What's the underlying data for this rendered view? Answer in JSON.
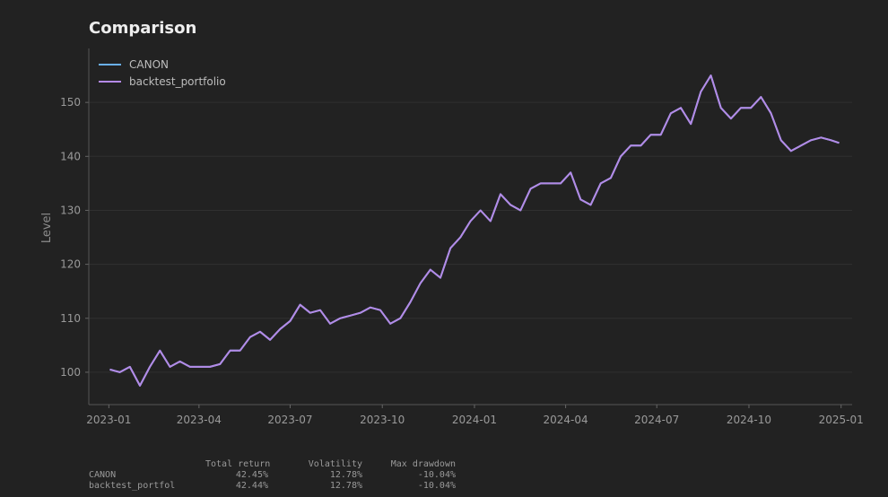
{
  "chart_data": {
    "type": "line",
    "title": "Comparison",
    "xlabel": "",
    "ylabel": "Level",
    "x_ticks": [
      "2023-01",
      "2023-04",
      "2023-07",
      "2023-10",
      "2024-01",
      "2024-04",
      "2024-07",
      "2024-10",
      "2025-01"
    ],
    "y_ticks": [
      100,
      110,
      120,
      130,
      140,
      150
    ],
    "xlim": [
      "2022-12-12",
      "2025-01-12"
    ],
    "ylim": [
      94,
      160
    ],
    "grid": "horizontal",
    "legend_position": "top-left",
    "colors": {
      "background": "#222222",
      "canon": "#6ab0ee",
      "backtest": "#b48ae6",
      "grid": "#303030"
    },
    "x": [
      "2023-01-02",
      "2023-01-12",
      "2023-01-22",
      "2023-02-01",
      "2023-02-11",
      "2023-02-21",
      "2023-03-03",
      "2023-03-13",
      "2023-03-23",
      "2023-04-02",
      "2023-04-12",
      "2023-04-22",
      "2023-05-02",
      "2023-05-12",
      "2023-05-22",
      "2023-06-01",
      "2023-06-11",
      "2023-06-21",
      "2023-07-01",
      "2023-07-11",
      "2023-07-21",
      "2023-07-31",
      "2023-08-10",
      "2023-08-20",
      "2023-08-30",
      "2023-09-09",
      "2023-09-19",
      "2023-09-29",
      "2023-10-09",
      "2023-10-19",
      "2023-10-29",
      "2023-11-08",
      "2023-11-18",
      "2023-11-28",
      "2023-12-08",
      "2023-12-18",
      "2023-12-28",
      "2024-01-07",
      "2024-01-17",
      "2024-01-27",
      "2024-02-06",
      "2024-02-16",
      "2024-02-26",
      "2024-03-07",
      "2024-03-17",
      "2024-03-27",
      "2024-04-06",
      "2024-04-16",
      "2024-04-26",
      "2024-05-06",
      "2024-05-16",
      "2024-05-26",
      "2024-06-05",
      "2024-06-15",
      "2024-06-25",
      "2024-07-05",
      "2024-07-15",
      "2024-07-25",
      "2024-08-04",
      "2024-08-14",
      "2024-08-24",
      "2024-09-03",
      "2024-09-13",
      "2024-09-23",
      "2024-10-03",
      "2024-10-13",
      "2024-10-23",
      "2024-11-02",
      "2024-11-12",
      "2024-11-22",
      "2024-12-02",
      "2024-12-12",
      "2024-12-22",
      "2024-12-30"
    ],
    "series": [
      {
        "name": "CANON",
        "values": [
          100.5,
          100.0,
          101.0,
          97.5,
          101.0,
          104.0,
          101.0,
          102.0,
          101.0,
          101.0,
          101.0,
          101.5,
          104.0,
          104.0,
          106.5,
          107.5,
          106.0,
          108.0,
          109.5,
          112.5,
          111.0,
          111.5,
          109.0,
          110.0,
          110.5,
          111.0,
          112.0,
          111.5,
          109.0,
          110.0,
          113.0,
          116.5,
          119.0,
          117.5,
          123.0,
          125.0,
          128.0,
          130.0,
          128.0,
          133.0,
          131.0,
          130.0,
          134.0,
          135.0,
          135.0,
          135.0,
          137.0,
          132.0,
          131.0,
          135.0,
          136.0,
          140.0,
          142.0,
          142.0,
          144.0,
          144.0,
          148.0,
          149.0,
          146.0,
          152.0,
          155.0,
          149.0,
          147.0,
          149.0,
          149.0,
          151.0,
          148.0,
          143.0,
          141.0,
          142.0,
          143.0,
          143.5,
          143.0,
          142.5
        ]
      },
      {
        "name": "backtest_portfolio",
        "values": [
          100.5,
          100.0,
          101.0,
          97.5,
          101.0,
          104.0,
          101.0,
          102.0,
          101.0,
          101.0,
          101.0,
          101.5,
          104.0,
          104.0,
          106.5,
          107.5,
          106.0,
          108.0,
          109.5,
          112.5,
          111.0,
          111.5,
          109.0,
          110.0,
          110.5,
          111.0,
          112.0,
          111.5,
          109.0,
          110.0,
          113.0,
          116.5,
          119.0,
          117.5,
          123.0,
          125.0,
          128.0,
          130.0,
          128.0,
          133.0,
          131.0,
          130.0,
          134.0,
          135.0,
          135.0,
          135.0,
          137.0,
          132.0,
          131.0,
          135.0,
          136.0,
          140.0,
          142.0,
          142.0,
          144.0,
          144.0,
          148.0,
          149.0,
          146.0,
          152.0,
          155.0,
          149.0,
          147.0,
          149.0,
          149.0,
          151.0,
          148.0,
          143.0,
          141.0,
          142.0,
          143.0,
          143.5,
          143.0,
          142.5
        ]
      }
    ]
  },
  "stats_table": {
    "headers": [
      "",
      "Total return",
      "Volatility",
      "Max drawdown"
    ],
    "rows": [
      [
        "CANON",
        "42.45%",
        "12.78%",
        "-10.04%"
      ],
      [
        "backtest_portfol",
        "42.44%",
        "12.78%",
        "-10.04%"
      ]
    ]
  }
}
